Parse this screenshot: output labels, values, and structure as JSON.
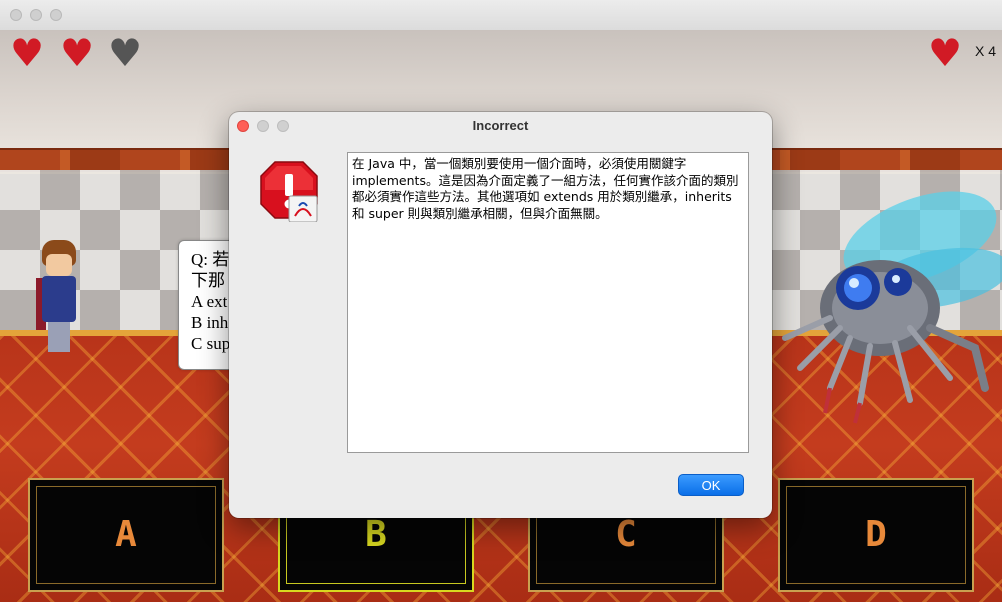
{
  "window": {
    "title": ""
  },
  "hud": {
    "hearts": [
      "full",
      "full",
      "empty"
    ],
    "lives_label": "X 4"
  },
  "question": {
    "lines": [
      "Q: 若",
      "下那",
      "A ext",
      "B inh",
      "C sup"
    ]
  },
  "answers": [
    {
      "letter": "A",
      "color": "#e8893a"
    },
    {
      "letter": "B",
      "color": "#d8d820"
    },
    {
      "letter": "C",
      "color": "#e8893a"
    },
    {
      "letter": "D",
      "color": "#e8893a"
    }
  ],
  "dialog": {
    "title": "Incorrect",
    "message_lines": [
      "在 Java 中，當一個類別要使用一個介面時，必須使用關鍵字",
      "implements。這是因為介面定義了一組方法，任何實作該介面的類別",
      "都必須實作這些方法。其他選項如 extends 用於類別繼承，inherits",
      "和 super 則與類別繼承相關，但與介面無關。"
    ],
    "ok_label": "OK"
  },
  "colors": {
    "ok_button": "#0a6fe8",
    "heart_full": "#d11a25",
    "heart_empty": "#555555",
    "close_dot": "#ff5f57"
  }
}
